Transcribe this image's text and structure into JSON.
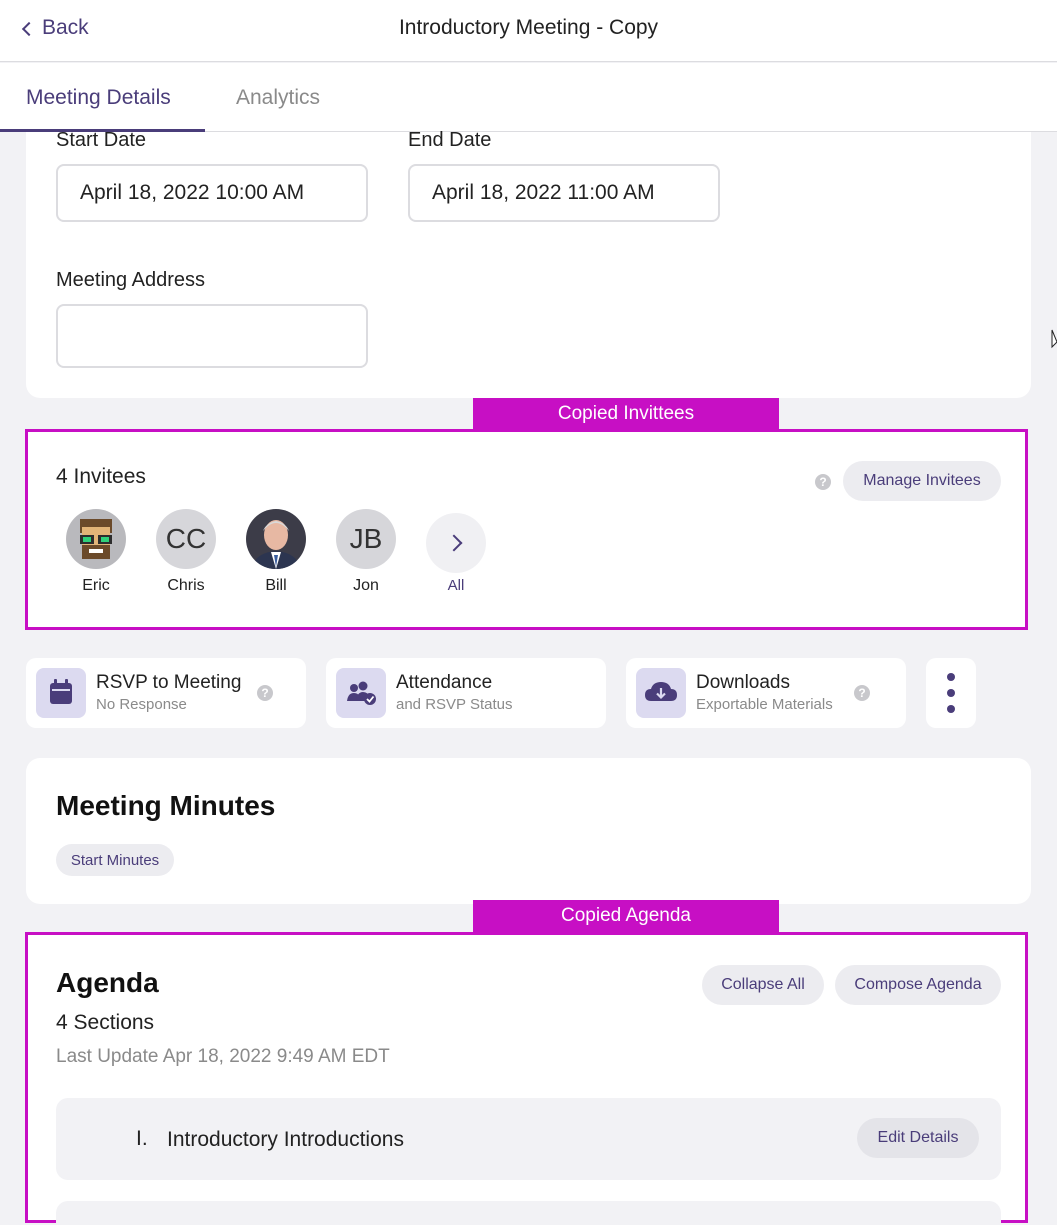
{
  "header": {
    "back_label": "Back",
    "title": "Introductory Meeting - Copy"
  },
  "tabs": [
    {
      "label": "Meeting Details"
    },
    {
      "label": "Analytics"
    }
  ],
  "details": {
    "start_label": "Start Date",
    "start_value": "April 18, 2022 10:00 AM",
    "end_label": "End Date",
    "end_value": "April 18, 2022 11:00 AM",
    "address_label": "Meeting Address",
    "address_value": ""
  },
  "tags": {
    "invitees": "Copied Invittees",
    "agenda": "Copied Agenda"
  },
  "invitees": {
    "count_label": "4 Invitees",
    "manage_label": "Manage Invitees",
    "help": "?",
    "people": [
      {
        "name": "Eric",
        "initials": ""
      },
      {
        "name": "Chris",
        "initials": "CC"
      },
      {
        "name": "Bill",
        "initials": ""
      },
      {
        "name": "Jon",
        "initials": "JB"
      }
    ],
    "all_label": "All"
  },
  "tiles": [
    {
      "title": "RSVP to Meeting",
      "subtitle": "No Response",
      "icon": "calendar-icon"
    },
    {
      "title": "Attendance",
      "subtitle": "and RSVP Status",
      "icon": "people-check-icon"
    },
    {
      "title": "Downloads",
      "subtitle": "Exportable Materials",
      "icon": "cloud-download-icon"
    }
  ],
  "minutes": {
    "title": "Meeting Minutes",
    "start_label": "Start Minutes"
  },
  "agenda": {
    "title": "Agenda",
    "sections_label": "4 Sections",
    "last_update": "Last Update Apr 18, 2022 9:49 AM EDT",
    "collapse_label": "Collapse All",
    "compose_label": "Compose Agenda",
    "items": [
      {
        "number": "I.",
        "title": "Introductory Introductions",
        "edit_label": "Edit Details"
      }
    ]
  },
  "colors": {
    "accent": "#4a3d7a",
    "highlight": "#c70fc4"
  }
}
